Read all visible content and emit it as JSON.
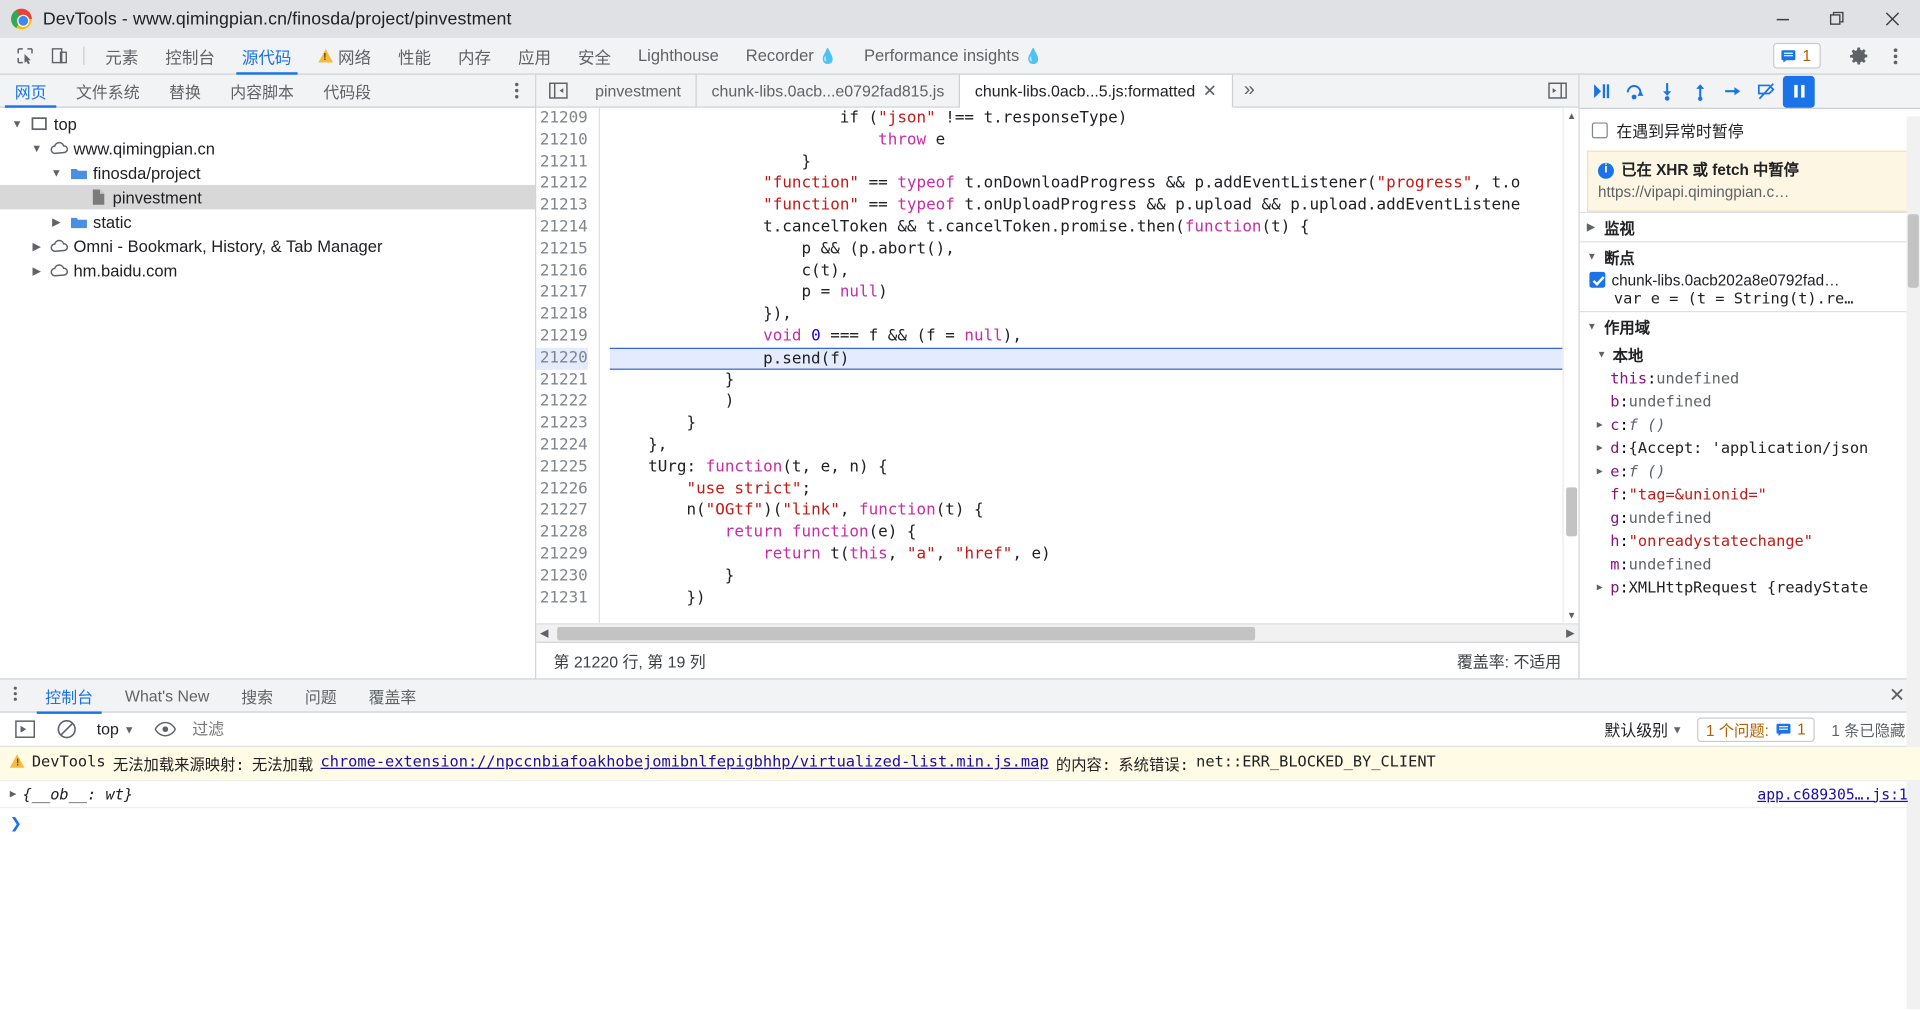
{
  "window": {
    "title": "DevTools - www.qimingpian.cn/finosda/project/pinvestment",
    "controls": {
      "minimize": "minimize-icon",
      "maximize": "restore-icon",
      "close": "close-icon"
    }
  },
  "main_tabs": {
    "items": [
      {
        "label": "元素",
        "active": false,
        "warn": false
      },
      {
        "label": "控制台",
        "active": false,
        "warn": false
      },
      {
        "label": "源代码",
        "active": true,
        "warn": false
      },
      {
        "label": "网络",
        "active": false,
        "warn": true
      },
      {
        "label": "性能",
        "active": false,
        "warn": false
      },
      {
        "label": "内存",
        "active": false,
        "warn": false
      },
      {
        "label": "应用",
        "active": false,
        "warn": false
      },
      {
        "label": "安全",
        "active": false,
        "warn": false
      },
      {
        "label": "Lighthouse",
        "active": false,
        "warn": false
      },
      {
        "label": "Recorder",
        "active": false,
        "warn": false,
        "flask": true
      },
      {
        "label": "Performance insights",
        "active": false,
        "warn": false,
        "flask": true
      }
    ],
    "issues_count": "1",
    "settings_icon": "gear-icon",
    "more_icon": "more-vertical-icon",
    "inspect_icon": "inspect-element-icon",
    "device_icon": "device-toolbar-icon"
  },
  "navigator": {
    "tabs": [
      {
        "label": "网页",
        "active": true
      },
      {
        "label": "文件系统",
        "active": false
      },
      {
        "label": "替换",
        "active": false
      },
      {
        "label": "内容脚本",
        "active": false
      },
      {
        "label": "代码段",
        "active": false
      }
    ],
    "more_icon": "more-vertical-icon",
    "tree": [
      {
        "label": "top",
        "icon": "frame-icon",
        "indent": 0,
        "twisty": "open",
        "selected": false
      },
      {
        "label": "www.qimingpian.cn",
        "icon": "cloud-icon",
        "indent": 1,
        "twisty": "open",
        "selected": false
      },
      {
        "label": "finosda/project",
        "icon": "folder-icon",
        "indent": 2,
        "twisty": "open",
        "selected": false
      },
      {
        "label": "pinvestment",
        "icon": "document-icon",
        "indent": 3,
        "twisty": "none",
        "selected": true
      },
      {
        "label": "static",
        "icon": "folder-icon",
        "indent": 2,
        "twisty": "closed",
        "selected": false
      },
      {
        "label": "Omni - Bookmark, History, & Tab Manager",
        "icon": "cloud-icon",
        "indent": 1,
        "twisty": "closed",
        "selected": false
      },
      {
        "label": "hm.baidu.com",
        "icon": "cloud-icon",
        "indent": 1,
        "twisty": "closed",
        "selected": false
      }
    ]
  },
  "editor": {
    "nav_toggle_icon": "show-navigator-icon",
    "tabs": [
      {
        "label": "pinvestment",
        "active": false,
        "closable": false
      },
      {
        "label": "chunk-libs.0acb...e0792fad815.js",
        "active": false,
        "closable": false
      },
      {
        "label": "chunk-libs.0acb...5.js:formatted",
        "active": true,
        "closable": true
      }
    ],
    "overflow_icon": "chevron-double-right-icon",
    "sidebar_toggle_icon": "show-debugger-sidebar-icon",
    "first_line_number": 21209,
    "highlight_line": 21220,
    "lines": [
      {
        "n": 21209,
        "html": "                        if (\"json\" !== t.responseType)"
      },
      {
        "n": 21210,
        "html": "                            throw e"
      },
      {
        "n": 21211,
        "html": "                    }"
      },
      {
        "n": 21212,
        "html": "                \"function\" == typeof t.onDownloadProgress && p.addEventListener(\"progress\", t.o"
      },
      {
        "n": 21213,
        "html": "                \"function\" == typeof t.onUploadProgress && p.upload && p.upload.addEventListene"
      },
      {
        "n": 21214,
        "html": "                t.cancelToken && t.cancelToken.promise.then(function(t) {"
      },
      {
        "n": 21215,
        "html": "                    p && (p.abort(),"
      },
      {
        "n": 21216,
        "html": "                    c(t),"
      },
      {
        "n": 21217,
        "html": "                    p = null)"
      },
      {
        "n": 21218,
        "html": "                }),"
      },
      {
        "n": 21219,
        "html": "                void 0 === f && (f = null),"
      },
      {
        "n": 21220,
        "html": "                p.send(f)"
      },
      {
        "n": 21221,
        "html": "            }"
      },
      {
        "n": 21222,
        "html": "            )"
      },
      {
        "n": 21223,
        "html": "        }"
      },
      {
        "n": 21224,
        "html": "    },"
      },
      {
        "n": 21225,
        "html": "    tUrg: function(t, e, n) {"
      },
      {
        "n": 21226,
        "html": "        \"use strict\";"
      },
      {
        "n": 21227,
        "html": "        n(\"OGtf\")(\"link\", function(t) {"
      },
      {
        "n": 21228,
        "html": "            return function(e) {"
      },
      {
        "n": 21229,
        "html": "                return t(this, \"a\", \"href\", e)"
      },
      {
        "n": 21230,
        "html": "            }"
      },
      {
        "n": 21231,
        "html": "        })"
      }
    ],
    "status": {
      "position": "第 21220 行, 第 19 列",
      "coverage": "覆盖率: 不适用"
    }
  },
  "debugger": {
    "toolbar": [
      {
        "name": "resume-button",
        "icon": "resume-icon"
      },
      {
        "name": "step-over-button",
        "icon": "step-over-icon"
      },
      {
        "name": "step-into-button",
        "icon": "step-into-icon"
      },
      {
        "name": "step-out-button",
        "icon": "step-out-icon"
      },
      {
        "name": "step-button",
        "icon": "step-icon"
      },
      {
        "name": "deactivate-breakpoints-button",
        "icon": "deactivate-breakpoints-icon"
      },
      {
        "name": "pause-on-exceptions-button",
        "icon": "pause-icon"
      }
    ],
    "pause_on_exceptions": {
      "label": "在遇到异常时暂停",
      "checked": false
    },
    "notice": {
      "title": "已在 XHR 或 fetch 中暂停",
      "url": "https://vipapi.qimingpian.c…"
    },
    "sections": [
      {
        "label": "监视",
        "expanded": false
      },
      {
        "label": "断点",
        "expanded": true
      },
      {
        "label": "作用域",
        "expanded": true
      }
    ],
    "breakpoint": {
      "checked": true,
      "file": "chunk-libs.0acb202a8e0792fad…",
      "source": "var e = (t = String(t).re…"
    },
    "scope_name": "本地",
    "scope_vars": [
      {
        "name": "this",
        "value": "undefined",
        "kind": "undef",
        "expandable": false,
        "special": false
      },
      {
        "name": "b",
        "value": "undefined",
        "kind": "undef",
        "expandable": false,
        "special": false
      },
      {
        "name": "c",
        "value": "f ()",
        "kind": "fn",
        "expandable": true,
        "special": false
      },
      {
        "name": "d",
        "value": "{Accept: 'application/json",
        "kind": "obj",
        "expandable": true,
        "special": false
      },
      {
        "name": "e",
        "value": "f ()",
        "kind": "fn",
        "expandable": true,
        "special": false
      },
      {
        "name": "f",
        "value": "\"tag=&unionid=\"",
        "kind": "str",
        "expandable": false,
        "special": false
      },
      {
        "name": "g",
        "value": "undefined",
        "kind": "undef",
        "expandable": false,
        "special": false
      },
      {
        "name": "h",
        "value": "\"onreadystatechange\"",
        "kind": "str",
        "expandable": false,
        "special": false
      },
      {
        "name": "m",
        "value": "undefined",
        "kind": "undef",
        "expandable": false,
        "special": false
      },
      {
        "name": "p",
        "value": "XMLHttpRequest {readyState",
        "kind": "obj",
        "expandable": true,
        "special": false
      }
    ]
  },
  "drawer": {
    "menu_icon": "more-vertical-icon",
    "tabs": [
      {
        "label": "控制台",
        "active": true
      },
      {
        "label": "What's New",
        "active": false
      },
      {
        "label": "搜索",
        "active": false
      },
      {
        "label": "问题",
        "active": false
      },
      {
        "label": "覆盖率",
        "active": false
      }
    ],
    "close_icon": "close-icon",
    "toolbar": {
      "execute_icon": "console-execute-icon",
      "clear_icon": "clear-console-icon",
      "context": "top",
      "eye_icon": "live-expression-icon",
      "filter_placeholder": "过滤",
      "filter_value": "",
      "level": "默认级别",
      "issues_label": "1 个问题:",
      "issues_count": "1",
      "hidden_label": "1 条已隐藏"
    },
    "messages": [
      {
        "type": "warning",
        "icon": "warning-icon",
        "prefix": "DevTools",
        "text1": "无法加载来源映射:",
        "text2": "无法加载",
        "link": "chrome-extension://npccnbiafoakhobejomibnlfepigbhhp/virtualized-list.min.js.map",
        "text3": "的内容:",
        "text4": "系统错误:",
        "text5": "net::ERR_BLOCKED_BY_CLIENT",
        "source": ""
      },
      {
        "type": "object",
        "expander": "▶",
        "text": "{__ob__: wt}",
        "source": "app.c689305….js:1"
      }
    ],
    "prompt": ">"
  },
  "colors": {
    "accent": "#1a73e8",
    "warning": "#f5bb41",
    "highlight": "#e3ebfd",
    "selection": "#d8d8d8",
    "notice_bg": "#fdf6e3"
  }
}
